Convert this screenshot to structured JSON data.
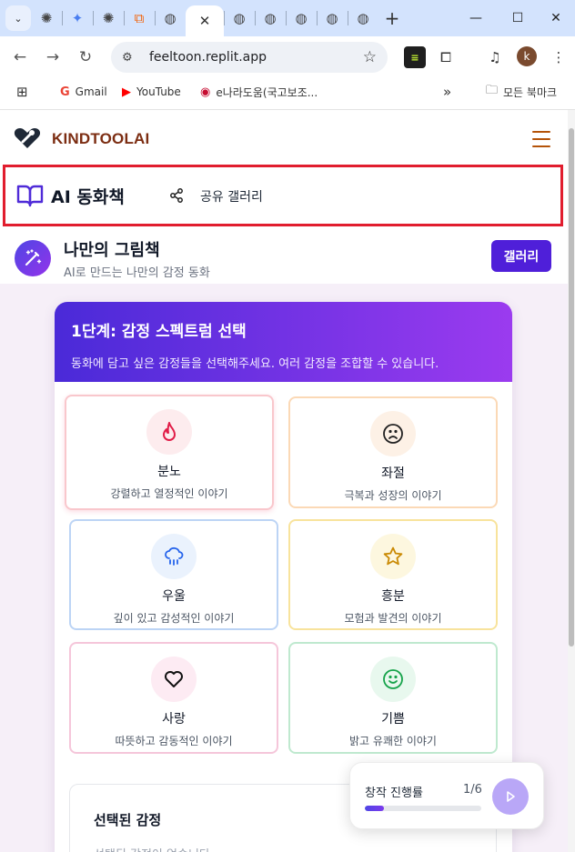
{
  "browser": {
    "tab_menu": "⌄",
    "new_tab": "+",
    "active_tab_close": "✕",
    "url": "feeltoon.replit.app",
    "bookmarks": [
      {
        "label": "Gmail",
        "icon": "gmail-icon"
      },
      {
        "label": "YouTube",
        "icon": "youtube-icon"
      },
      {
        "label": "e나라도움(국고보조...",
        "icon": "korea-emblem-icon"
      }
    ],
    "bookmarks_overflow": "»",
    "all_bookmarks": "모든 북마크",
    "profile_initial": "k",
    "ext_logo": "≡"
  },
  "site": {
    "brand": "KINDTOOLAI"
  },
  "sub_nav": {
    "title": "AI 동화책",
    "share_label": "공유 갤러리"
  },
  "page_bar": {
    "title": "나만의 그림책",
    "subtitle": "AI로 만드는 나만의 감정 동화",
    "gallery_button": "갤러리"
  },
  "step": {
    "title": "1단계: 감정 스펙트럼 선택",
    "description": "동화에 담고 싶은 감정들을 선택해주세요. 여러 감정을 조합할 수 있습니다."
  },
  "emotions": [
    {
      "name": "분노",
      "desc": "강렬하고 열정적인 이야기",
      "icon": "flame-icon",
      "border": "#f9c7cc",
      "circle": "#fdecee",
      "color": "#e11d48"
    },
    {
      "name": "좌절",
      "desc": "극복과 성장의 이야기",
      "icon": "frown-icon",
      "border": "#fbd9b6",
      "circle": "#fdf1e6",
      "color": "#222222"
    },
    {
      "name": "우울",
      "desc": "깊이 있고 감성적인 이야기",
      "icon": "cloud-rain-icon",
      "border": "#bcd4f5",
      "circle": "#eaf2fd",
      "color": "#2563eb"
    },
    {
      "name": "흥분",
      "desc": "모험과 발견의 이야기",
      "icon": "star-icon",
      "border": "#f8e39c",
      "circle": "#fdf7df",
      "color": "#ca8a04"
    },
    {
      "name": "사랑",
      "desc": "따뜻하고 감동적인 이야기",
      "icon": "heart-icon",
      "border": "#f5c6da",
      "circle": "#fdebf3",
      "color": "#111111"
    },
    {
      "name": "기쁨",
      "desc": "밝고 유쾌한 이야기",
      "icon": "smile-icon",
      "border": "#bfe9cf",
      "circle": "#e8f8ee",
      "color": "#16a34a"
    }
  ],
  "selected": {
    "title": "선택된 감정",
    "empty": "선택된 감정이 없습니다"
  },
  "progress": {
    "label": "창작 진행률",
    "count": "1/6",
    "fraction": 0.167
  }
}
